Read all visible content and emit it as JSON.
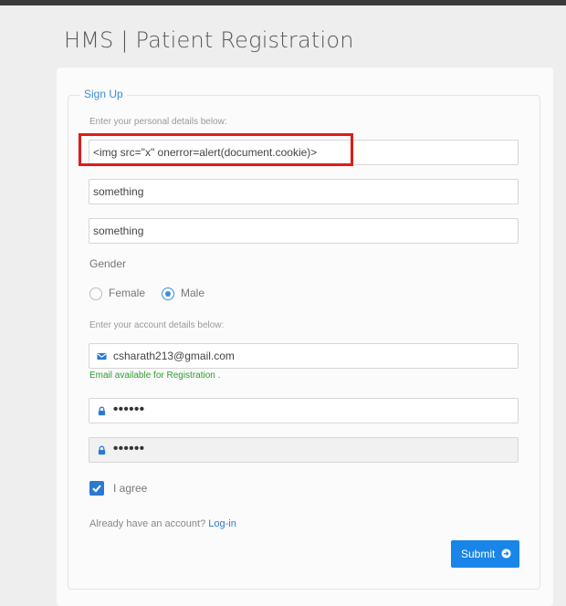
{
  "page_title": "HMS | Patient Registration",
  "form": {
    "legend": "Sign Up",
    "personal_hint": "Enter your personal details below:",
    "fields": {
      "full_name": "<img src=\"x\" onerror=alert(document.cookie)>",
      "address": "something",
      "city": "something"
    },
    "gender": {
      "label": "Gender",
      "options": [
        "Female",
        "Male"
      ],
      "selected": "Male"
    },
    "account_hint": "Enter your account details below:",
    "email": "csharath213@gmail.com",
    "email_status": "Email available for Registration .",
    "password_mask": "••••••",
    "confirm_password_mask": "••••••",
    "agree_label": "I agree",
    "agree_checked": true,
    "already_text": "Already have an account?",
    "login_link": "Log-in",
    "submit_label": "Submit"
  },
  "colors": {
    "accent": "#2a7ad1",
    "submit_bg": "#1a85e8",
    "highlight_border": "#e01a1a",
    "success_text": "#2e9b2e"
  },
  "icons": {
    "email": "envelope-icon",
    "password": "lock-icon",
    "submit": "arrow-right-circle-icon"
  }
}
